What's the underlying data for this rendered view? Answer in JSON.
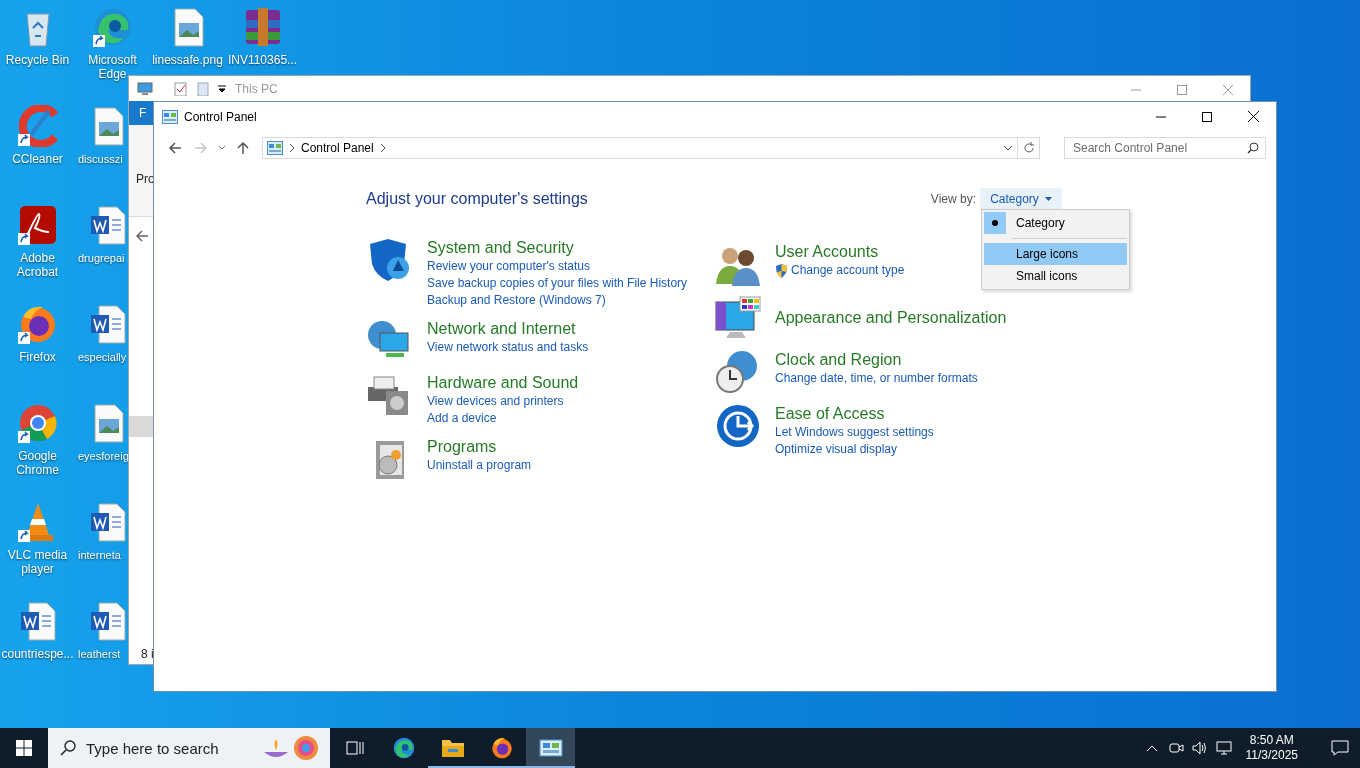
{
  "desktop": {
    "rows": [
      [
        {
          "label": "Recycle Bin",
          "kind": "recycle",
          "shortcut": false,
          "cut": false
        },
        {
          "label": "Microsoft Edge",
          "kind": "edge",
          "shortcut": true,
          "cut": false
        },
        {
          "label": "linessafe.png",
          "kind": "image",
          "shortcut": false,
          "cut": false
        },
        {
          "label": "INV110365...",
          "kind": "archive",
          "shortcut": false,
          "cut": false
        }
      ],
      [
        {
          "label": "CCleaner",
          "kind": "ccleaner",
          "shortcut": true,
          "cut": false
        },
        {
          "label": "discusszi",
          "kind": "image",
          "shortcut": false,
          "cut": true
        }
      ],
      [
        {
          "label": "Adobe Acrobat",
          "kind": "pdf",
          "shortcut": true,
          "cut": false
        },
        {
          "label": "drugrepai",
          "kind": "word",
          "shortcut": false,
          "cut": true
        }
      ],
      [
        {
          "label": "Firefox",
          "kind": "firefox",
          "shortcut": true,
          "cut": false
        },
        {
          "label": "especially",
          "kind": "word",
          "shortcut": false,
          "cut": true
        }
      ],
      [
        {
          "label": "Google Chrome",
          "kind": "chrome",
          "shortcut": true,
          "cut": false
        },
        {
          "label": "eyesforeig",
          "kind": "image",
          "shortcut": false,
          "cut": true
        }
      ],
      [
        {
          "label": "VLC media player",
          "kind": "vlc",
          "shortcut": true,
          "cut": false
        },
        {
          "label": "interneta",
          "kind": "word",
          "shortcut": false,
          "cut": true
        }
      ],
      [
        {
          "label": "countriespe...",
          "kind": "word",
          "shortcut": false,
          "cut": false
        },
        {
          "label": "leatherst",
          "kind": "word",
          "shortcut": false,
          "cut": true
        }
      ]
    ]
  },
  "explorer_window": {
    "title": "This PC",
    "ribbon_tab": "F",
    "ribbon_item": "Pro",
    "status": "8 i"
  },
  "control_panel": {
    "title": "Control Panel",
    "address": "Control Panel",
    "search": {
      "placeholder": "Search Control Panel"
    },
    "heading": "Adjust your computer's settings",
    "view_by": {
      "label": "View by:",
      "value": "Category",
      "menu": [
        {
          "label": "Category",
          "selected": true,
          "hovered": false
        },
        {
          "label": "Large icons",
          "selected": false,
          "hovered": true
        },
        {
          "label": "Small icons",
          "selected": false,
          "hovered": false
        }
      ]
    },
    "columns": [
      [
        {
          "title": "System and Security",
          "links": [
            {
              "text": "Review your computer's status",
              "shield": false
            },
            {
              "text": "Save backup copies of your files with File History",
              "shield": false
            },
            {
              "text": "Backup and Restore (Windows 7)",
              "shield": false
            }
          ]
        },
        {
          "title": "Network and Internet",
          "links": [
            {
              "text": "View network status and tasks",
              "shield": false
            }
          ]
        },
        {
          "title": "Hardware and Sound",
          "links": [
            {
              "text": "View devices and printers",
              "shield": false
            },
            {
              "text": "Add a device",
              "shield": false
            }
          ]
        },
        {
          "title": "Programs",
          "links": [
            {
              "text": "Uninstall a program",
              "shield": false
            }
          ]
        }
      ],
      [
        {
          "title": "User Accounts",
          "links": [
            {
              "text": "Change account type",
              "shield": true
            }
          ]
        },
        {
          "title": "Appearance and Personalization"
        },
        {
          "title": "Clock and Region",
          "links": [
            {
              "text": "Change date, time, or number formats",
              "shield": false
            }
          ]
        },
        {
          "title": "Ease of Access",
          "links": [
            {
              "text": "Let Windows suggest settings",
              "shield": false
            },
            {
              "text": "Optimize visual display",
              "shield": false
            }
          ]
        }
      ]
    ]
  },
  "taskbar": {
    "search": {
      "placeholder": "Type here to search"
    },
    "apps": [
      {
        "kind": "taskview",
        "running": false,
        "active": false
      },
      {
        "kind": "edge",
        "running": false,
        "active": false
      },
      {
        "kind": "explorer",
        "running": true,
        "active": false
      },
      {
        "kind": "firefox",
        "running": true,
        "active": false
      },
      {
        "kind": "controlpanel",
        "running": true,
        "active": true
      }
    ],
    "time": "8:50 AM",
    "date": "11/3/2025"
  }
}
